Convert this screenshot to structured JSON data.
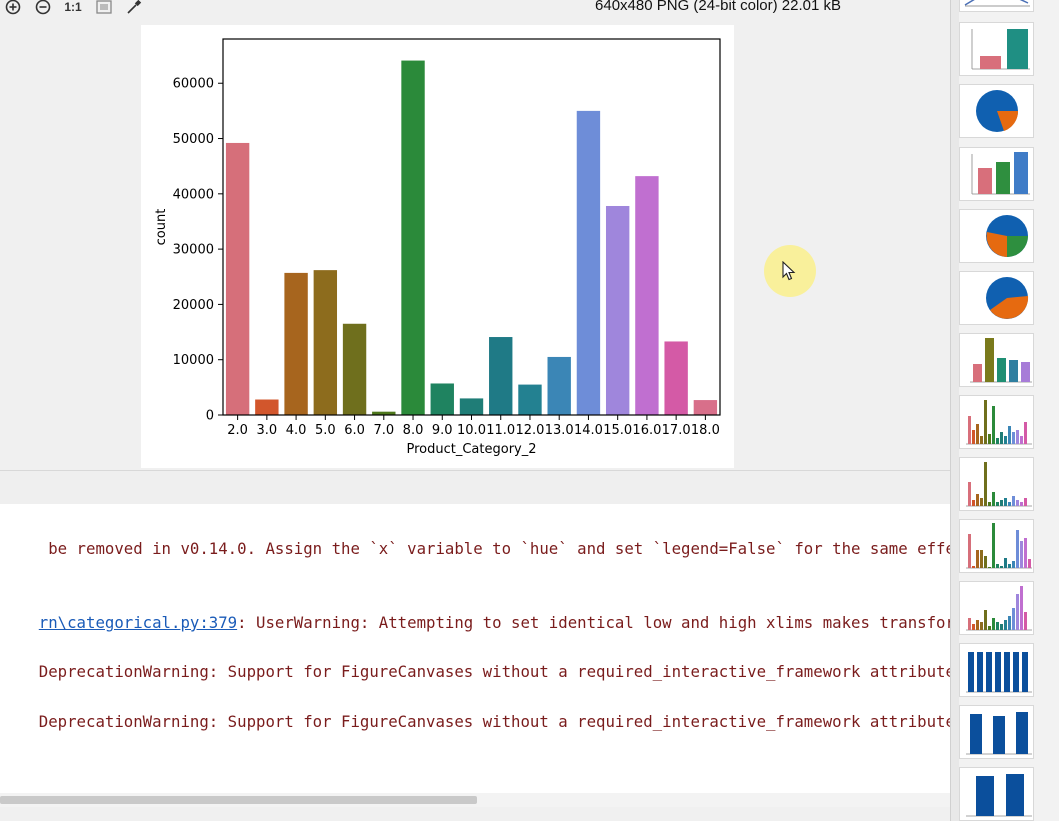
{
  "toolbar": {
    "zoom_in_icon": "zoom-in-icon",
    "zoom_out_icon": "zoom-out-icon",
    "actual_size_label": "1:1",
    "fit_icon": "fit-window-icon",
    "eyedropper_icon": "eyedropper-icon",
    "image_info": "640x480 PNG (24-bit color) 22.01 kB"
  },
  "colors": {
    "console_text": "#7a1c1c",
    "link": "#1a5bb8",
    "cursor_highlight": "#f8ee8c"
  },
  "chart_data": {
    "type": "bar",
    "xlabel": "Product_Category_2",
    "ylabel": "count",
    "ylim": [
      0,
      68000
    ],
    "yticks": [
      0,
      10000,
      20000,
      30000,
      40000,
      50000,
      60000
    ],
    "grid": false,
    "categories": [
      "2.0",
      "3.0",
      "4.0",
      "5.0",
      "6.0",
      "7.0",
      "8.0",
      "9.0",
      "10.0",
      "11.0",
      "12.0",
      "13.0",
      "14.0",
      "15.0",
      "16.0",
      "17.0",
      "18.0"
    ],
    "values": [
      49200,
      2800,
      25700,
      26200,
      16500,
      600,
      64100,
      5700,
      3000,
      14100,
      5500,
      10500,
      55000,
      37800,
      43200,
      13300,
      2700
    ],
    "colors": [
      "#d66f7a",
      "#d2562c",
      "#a7651e",
      "#8d6c1d",
      "#6f6f1d",
      "#4e781c",
      "#2b8a3a",
      "#1f8360",
      "#1f7d77",
      "#1f7a86",
      "#238191",
      "#3b86b6",
      "#6e8dd8",
      "#9f86dc",
      "#c06fd0",
      "#d45aa6",
      "#d86f8a"
    ]
  },
  "console": {
    "lines": [
      {
        "text": " be removed in v0.14.0. Assign the `x` variable to `hue` and set `legend=False` for the same effect."
      },
      {
        "link": "rn\\categorical.py:379",
        "text": ": UserWarning: Attempting to set identical low and high xlims makes transformation singular"
      },
      {
        "text": "DeprecationWarning: Support for FigureCanvases without a required_interactive_framework attribute was deprecated"
      },
      {
        "text": "DeprecationWarning: Support for FigureCanvases without a required_interactive_framework attribute was deprecated"
      }
    ]
  },
  "thumbnails": [
    {
      "name": "thumb-histogram"
    },
    {
      "name": "thumb-bar-two"
    },
    {
      "name": "thumb-pie-1"
    },
    {
      "name": "thumb-bar-three"
    },
    {
      "name": "thumb-pie-2"
    },
    {
      "name": "thumb-pie-3"
    },
    {
      "name": "thumb-bar-multi-1"
    },
    {
      "name": "thumb-bar-multi-2"
    },
    {
      "name": "thumb-bar-multi-3"
    },
    {
      "name": "thumb-bar-multi-4"
    },
    {
      "name": "thumb-bar-multi-5"
    },
    {
      "name": "thumb-bar-blue-1"
    },
    {
      "name": "thumb-bar-blue-2"
    },
    {
      "name": "thumb-bar-blue-3"
    }
  ]
}
